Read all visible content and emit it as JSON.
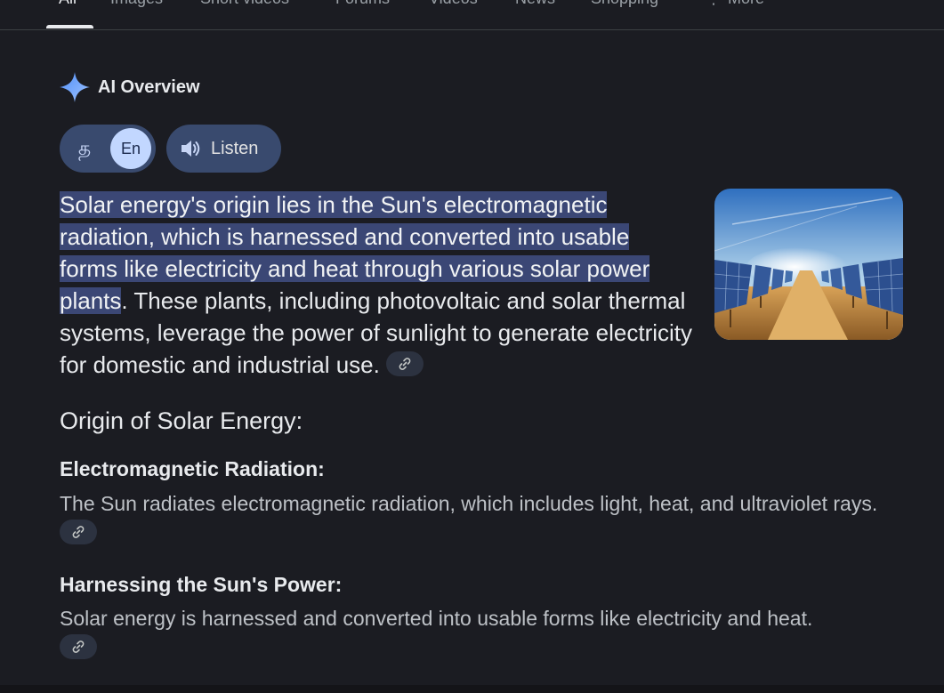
{
  "tabs": [
    {
      "label": "All",
      "active": true
    },
    {
      "label": "Images"
    },
    {
      "label": "Short videos"
    },
    {
      "label": "Forums"
    },
    {
      "label": "Videos"
    },
    {
      "label": "News"
    },
    {
      "label": "Shopping"
    },
    {
      "label": "More"
    }
  ],
  "ai_overview": {
    "title": "AI Overview",
    "lang_alt_glyph": "த",
    "lang_active": "En",
    "listen_label": "Listen",
    "summary_highlight": "Solar energy's origin lies in the Sun's electromagnetic radiation, which is harnessed and converted into usable forms like electricity and heat through various solar power plants",
    "summary_rest": ". These plants, including photovoltaic and solar thermal systems, leverage the power of sunlight to generate electricity for domestic and industrial use.",
    "thumbnail_icon": "solar-panels-image"
  },
  "origin": {
    "heading": "Origin of Solar Energy:",
    "items": [
      {
        "title": "Electromagnetic Radiation:",
        "text": "The Sun radiates electromagnetic radiation, which includes light, heat, and ultraviolet rays."
      },
      {
        "title": "Harnessing the Sun's Power:",
        "text": "Solar energy is harnessed and converted into usable forms like electricity and heat."
      }
    ]
  },
  "colors": {
    "background": "#1b1c22",
    "highlight": "#3b4775",
    "chip": "#394a6e",
    "accent": "#8ab4f8"
  }
}
